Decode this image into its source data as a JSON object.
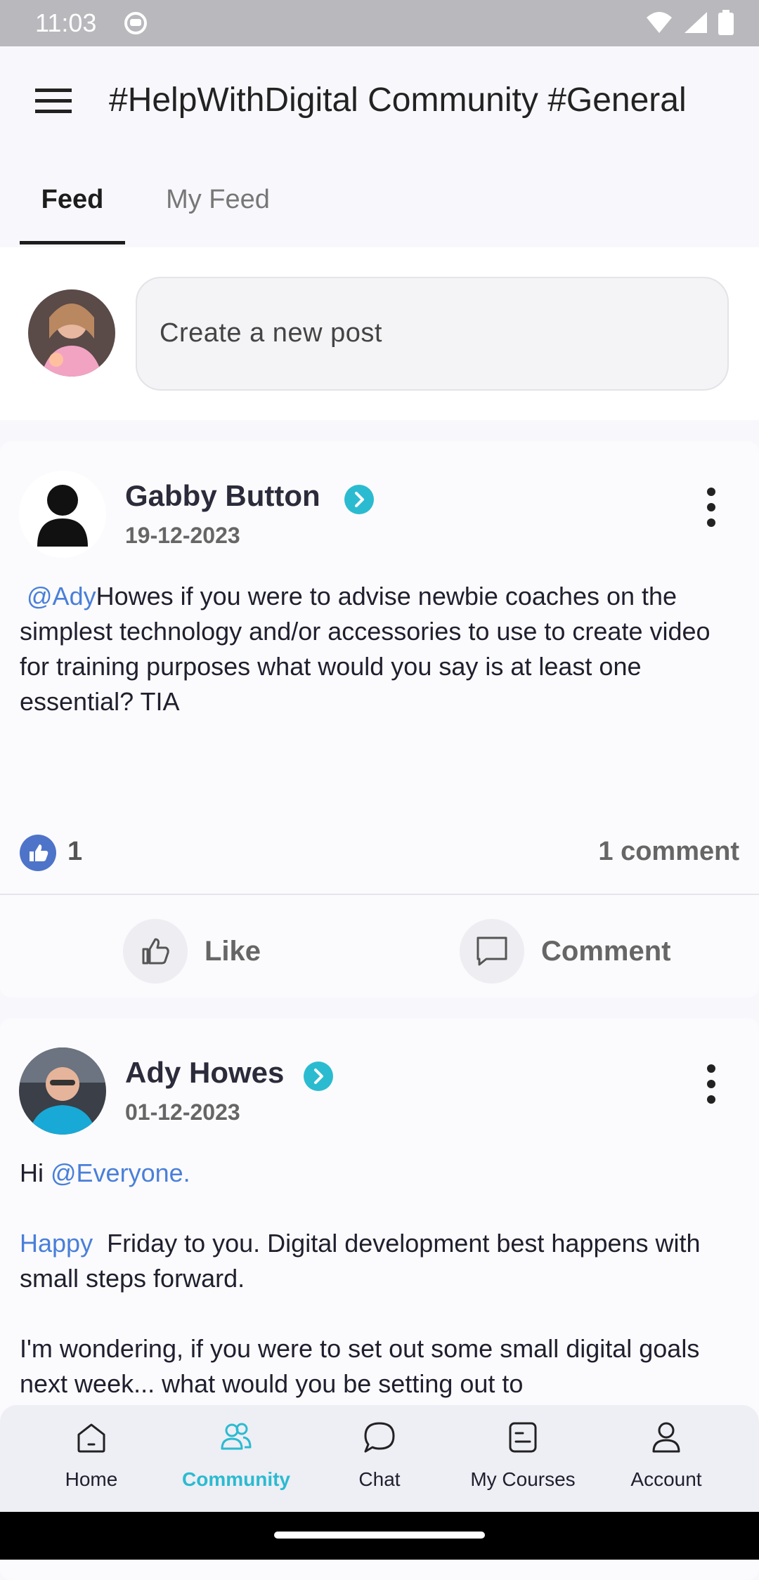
{
  "status_bar": {
    "time": "11:03"
  },
  "header": {
    "title": "#HelpWithDigital Community #General"
  },
  "tabs": [
    {
      "label": "Feed",
      "active": true
    },
    {
      "label": "My Feed",
      "active": false
    }
  ],
  "composer": {
    "placeholder": "Create a new post"
  },
  "posts": [
    {
      "author": "Gabby Button",
      "date": "19-12-2023",
      "mention": "@Ady",
      "body": "Howes if you were to advise newbie coaches on the simplest technology and/or accessories to use to create video for training purposes what would you say is at least one essential? TIA",
      "likes": "1",
      "comments": "1 comment",
      "like_label": "Like",
      "comment_label": "Comment"
    },
    {
      "author": "Ady Howes",
      "date": "01-12-2023",
      "line1_prefix": "Hi ",
      "line1_mention": "@Everyone.",
      "para2_highlight": "Happy",
      "para2_text": "Friday to you. Digital development best happens with small steps forward.",
      "para3_text": "I'm wondering, if you were to set out some small digital goals next week... what would you be setting out to"
    }
  ],
  "bottom_nav": [
    {
      "label": "Home",
      "icon": "home-icon",
      "active": false
    },
    {
      "label": "Community",
      "icon": "community-icon",
      "active": true
    },
    {
      "label": "Chat",
      "icon": "chat-icon",
      "active": false
    },
    {
      "label": "My Courses",
      "icon": "courses-icon",
      "active": false
    },
    {
      "label": "Account",
      "icon": "account-icon",
      "active": false
    }
  ],
  "colors": {
    "accent": "#2bbbd0",
    "mention": "#4a7fd9",
    "like_badge": "#4e74c9"
  }
}
